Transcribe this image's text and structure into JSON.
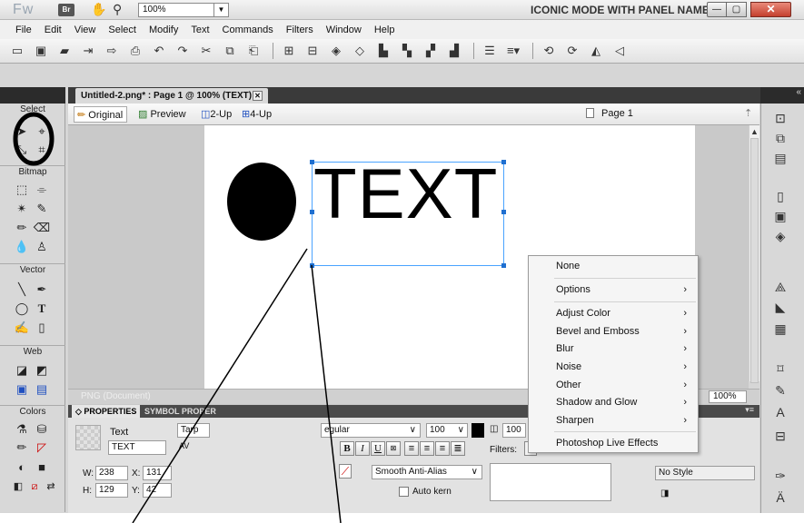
{
  "app": {
    "logo": "Fw",
    "bridge_label": "Br",
    "zoom_value": "100%",
    "workspace": "ICONIC MODE WITH PANEL NAMES ▼",
    "minimize": "—",
    "maximize": "▢",
    "close": "✕"
  },
  "menu": [
    "File",
    "Edit",
    "View",
    "Select",
    "Modify",
    "Text",
    "Commands",
    "Filters",
    "Window",
    "Help"
  ],
  "document": {
    "tab_title": "Untitled-2.png* : Page 1 @ 100% (TEXT)",
    "tab_close": "✕",
    "views": [
      "Original",
      "Preview",
      "2-Up",
      "4-Up"
    ],
    "page": "Page 1",
    "status": "PNG (Document)",
    "zoom": "100%"
  },
  "canvas": {
    "text_object": "TEXT"
  },
  "tools": {
    "select_header": "Select",
    "bitmap_header": "Bitmap",
    "vector_header": "Vector",
    "web_header": "Web",
    "colors_header": "Colors"
  },
  "properties": {
    "tab_active": "PROPERTIES",
    "tab_inactive": "SYMBOL PROPER",
    "object_type": "Text",
    "object_name": "TEXT",
    "font_partial": "Tarp",
    "av": "AV",
    "style": "egular",
    "size": "100",
    "leading": "100",
    "bold": "B",
    "italic": "I",
    "underline": "U",
    "antialias": "Smooth Anti-Alias",
    "autokern": "Auto kern",
    "filters_label": "Filters:",
    "w_label": "W:",
    "w_value": "238",
    "x_label": "X:",
    "x_value": "131",
    "h_label": "H:",
    "h_value": "129",
    "y_label": "Y:",
    "y_value": "42",
    "no_style": "No Style"
  },
  "context_menu": {
    "items": [
      "None",
      "Options",
      "Adjust Color",
      "Bevel and Emboss",
      "Blur",
      "Noise",
      "Other",
      "Shadow and Glow",
      "Sharpen",
      "Photoshop Live Effects"
    ],
    "submenu_arrow": "›"
  },
  "colors": {
    "selection": "#4aa3ff",
    "close_button": "#c4402e",
    "panel_dark": "#2b2b2b"
  }
}
